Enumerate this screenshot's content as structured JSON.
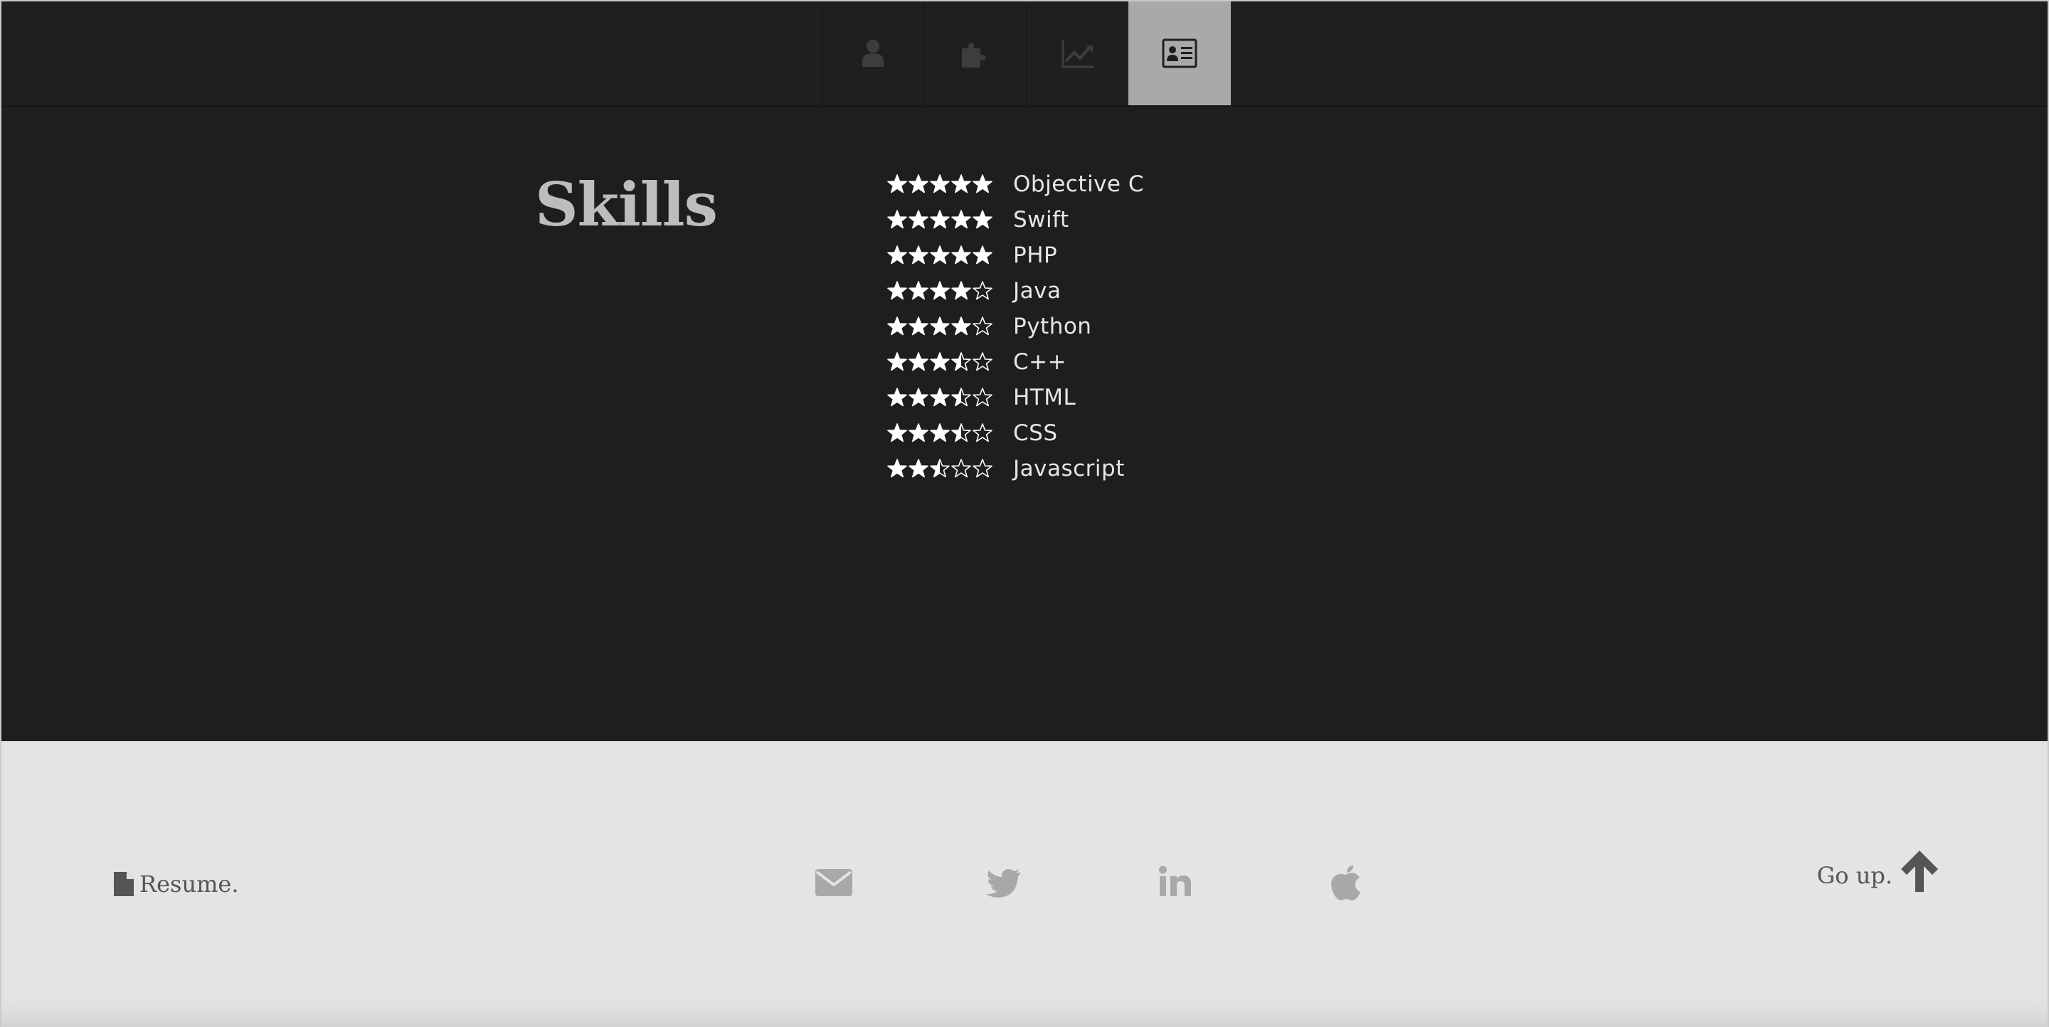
{
  "nav": {
    "tabs": [
      {
        "icon": "user-icon",
        "active": false
      },
      {
        "icon": "puzzle-icon",
        "active": false
      },
      {
        "icon": "line-chart-icon",
        "active": false
      },
      {
        "icon": "contact-card-icon",
        "active": true
      }
    ],
    "colors": {
      "inactive_icon": "#3d3d3d",
      "active_bg": "#a9a9a9",
      "active_icon": "#1f1f1f"
    }
  },
  "skills": {
    "title": "Skills",
    "items": [
      {
        "name": "Objective C",
        "rating": 5
      },
      {
        "name": "Swift",
        "rating": 5
      },
      {
        "name": "PHP",
        "rating": 5
      },
      {
        "name": "Java",
        "rating": 4
      },
      {
        "name": "Python",
        "rating": 4
      },
      {
        "name": "C++",
        "rating": 3.5
      },
      {
        "name": "HTML",
        "rating": 3.5
      },
      {
        "name": "CSS",
        "rating": 3.5
      },
      {
        "name": "Javascript",
        "rating": 2.5
      }
    ],
    "max_rating": 5,
    "star_color": "#ffffff"
  },
  "footer": {
    "resume_label": "Resume.",
    "resume_icon": "file-icon",
    "social": [
      {
        "icon": "envelope-icon"
      },
      {
        "icon": "twitter-icon"
      },
      {
        "icon": "linkedin-icon"
      },
      {
        "icon": "apple-icon"
      }
    ],
    "goup_label": "Go up.",
    "goup_icon": "arrow-up-icon",
    "social_color": "#a8a8a8",
    "text_color": "#555555"
  }
}
